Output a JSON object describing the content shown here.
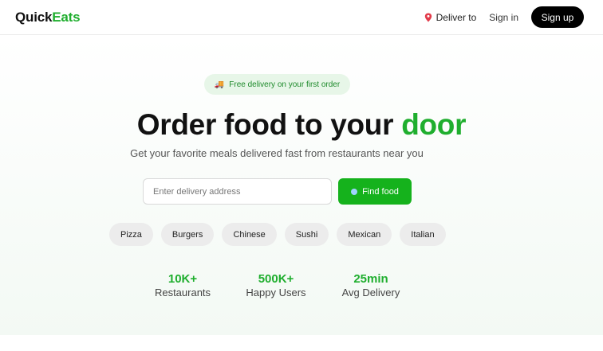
{
  "header": {
    "logo_part1": "Quick",
    "logo_part2": "Eats",
    "deliver_label": "Deliver to",
    "signin_label": "Sign in",
    "signup_label": "Sign up"
  },
  "hero": {
    "promo_text": "Free delivery on your first order",
    "headline_main": "Order food to your ",
    "headline_accent": "door",
    "subheadline": "Get your favorite meals delivered fast from restaurants near you",
    "search_placeholder": "Enter delivery address",
    "find_button": "Find food"
  },
  "categories": [
    "Pizza",
    "Burgers",
    "Chinese",
    "Sushi",
    "Mexican",
    "Italian"
  ],
  "stats": [
    {
      "value": "10K+",
      "label": "Restaurants"
    },
    {
      "value": "500K+",
      "label": "Happy Users"
    },
    {
      "value": "25min",
      "label": "Avg Delivery"
    }
  ],
  "colors": {
    "accent": "#1fae2e",
    "button_green": "#15b21c",
    "signup_bg": "#000000",
    "promo_bg": "#e7f6e8"
  },
  "icons": {
    "deliver": "map-pin-icon",
    "promo": "truck-icon",
    "find": "search-dot-icon"
  }
}
